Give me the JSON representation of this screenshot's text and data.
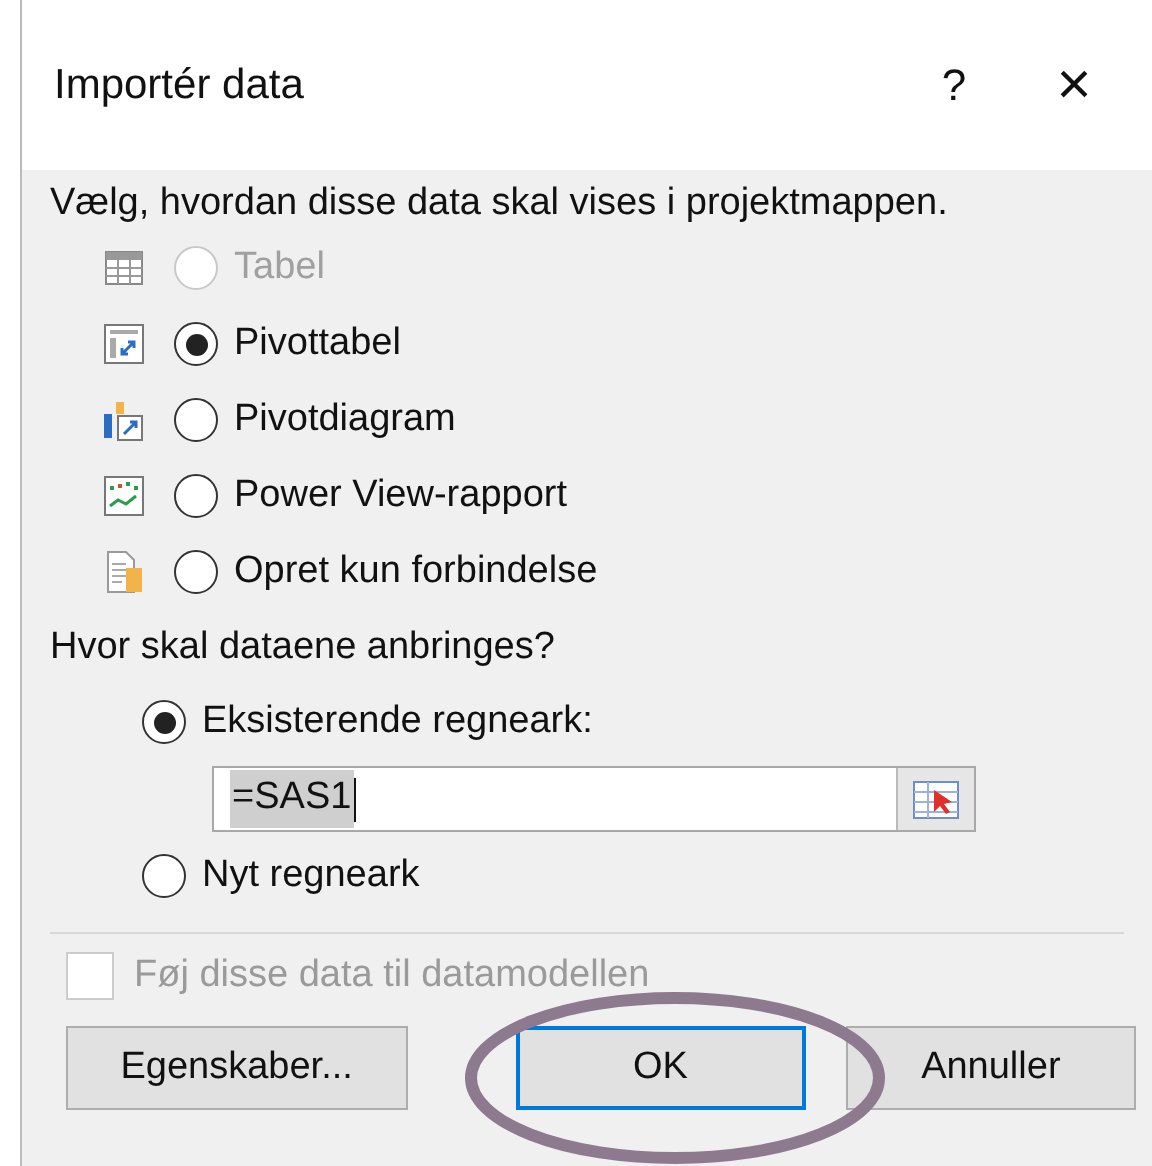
{
  "dialog": {
    "title": "Importér data",
    "help_button": "?",
    "close_button": "×"
  },
  "view_prompt": "Vælg, hvordan disse data skal vises i projektmappen.",
  "view_options": [
    {
      "kind": "table",
      "label": "Tabel",
      "selected": false,
      "disabled": true
    },
    {
      "kind": "pivot_table",
      "label": "Pivottabel",
      "selected": true,
      "disabled": false
    },
    {
      "kind": "pivot_chart",
      "label": "Pivotdiagram",
      "selected": false,
      "disabled": false
    },
    {
      "kind": "power_view",
      "label": "Power View-rapport",
      "selected": false,
      "disabled": false
    },
    {
      "kind": "connection",
      "label": "Opret kun forbindelse",
      "selected": false,
      "disabled": false
    }
  ],
  "location_prompt": "Hvor skal dataene anbringes?",
  "location_options": [
    {
      "label": "Eksisterende regneark:",
      "selected": true,
      "field": {
        "value": "=SAS1"
      }
    },
    {
      "label": "Nyt regneark",
      "selected": false
    }
  ],
  "data_model_checkbox": {
    "label": "Føj disse data til datamodellen",
    "checked": false,
    "disabled": true
  },
  "buttons": [
    {
      "label": "Egenskaber...",
      "default": false
    },
    {
      "label": "OK",
      "default": true
    },
    {
      "label": "Annuller",
      "default": false
    }
  ]
}
